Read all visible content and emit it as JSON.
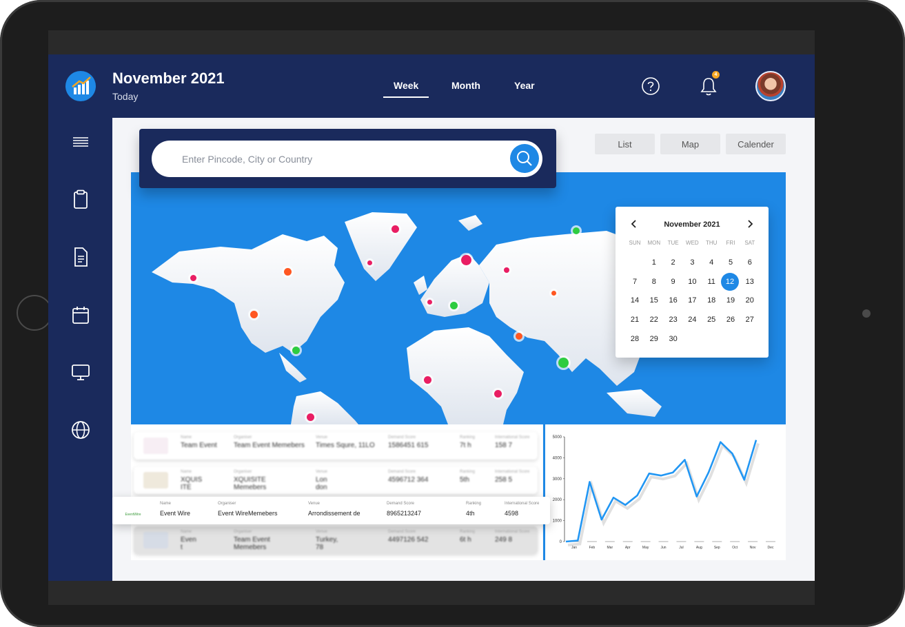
{
  "header": {
    "title": "November 2021",
    "subtitle": "Today",
    "tabs": [
      {
        "label": "Week",
        "active": true
      },
      {
        "label": "Month",
        "active": false
      },
      {
        "label": "Year",
        "active": false
      }
    ],
    "notification_count": "4",
    "icons": [
      "help-icon",
      "bell-icon",
      "user-avatar"
    ]
  },
  "sidebar": {
    "items": [
      "menu-icon",
      "clipboard-icon",
      "document-icon",
      "calendar-icon",
      "monitor-icon",
      "globe-icon"
    ]
  },
  "search": {
    "placeholder": "Enter Pincode, City or Country"
  },
  "view_buttons": [
    "List",
    "Map",
    "Calender"
  ],
  "calendar": {
    "month_label": "November 2021",
    "weekdays": [
      "SUN",
      "MON",
      "TUE",
      "WED",
      "THU",
      "FRI",
      "SAT"
    ],
    "start_offset": 1,
    "days_in_month": 30,
    "selected_day": 12
  },
  "events": {
    "rows": [
      {
        "name": "Team Event",
        "organiser": "Team Event Memebers",
        "venue": "Times Squre, 11LO",
        "demand": "1586451 615",
        "ranking": "7t h",
        "international": "158 7"
      },
      {
        "name": "XQUIS ITE",
        "organiser": "XQUISITE Memebers",
        "venue": "Lon don",
        "demand": "4596712 364",
        "ranking": "5th",
        "international": "258 5"
      },
      {
        "name": "Event Wire",
        "organiser": "Event WireMemebers",
        "venue": "Arrondissement de",
        "demand": "8965213247",
        "ranking": "4th",
        "international": "4598",
        "logo_text": "EventWire"
      },
      {
        "name": "Even t",
        "organiser": "Team Event Memebers",
        "venue": "Turkey, 78",
        "demand": "4497126 542",
        "ranking": "6t h",
        "international": "249 8"
      }
    ],
    "labels": {
      "name": "Name",
      "organiser": "Organiser",
      "venue": "Venue",
      "demand": "Demand Score",
      "ranking": "Ranking",
      "international": "International Score"
    }
  },
  "chart_data": {
    "type": "line",
    "x": [
      "Jan",
      "Feb",
      "Mar",
      "Apr",
      "May",
      "Jun",
      "Jul",
      "Aug",
      "Sep",
      "Oct",
      "Nov",
      "Dec"
    ],
    "xticks": [
      "Jan",
      "Feb",
      "Mar",
      "Apr",
      "May",
      "Jun",
      "Jul",
      "Aug",
      "Sep",
      "Oct",
      "Nov",
      "Dec"
    ],
    "yticks": [
      "5000",
      "4000",
      "3000",
      "2000",
      "1000",
      "0"
    ],
    "ylim": [
      0,
      5000
    ],
    "series": [
      {
        "values": [
          0,
          50,
          2850,
          1050,
          2100,
          1750,
          2200,
          3250,
          3150,
          3300,
          3900,
          2150,
          3300,
          4750,
          4200,
          2950,
          4850
        ]
      }
    ],
    "color": "#2196f3"
  }
}
